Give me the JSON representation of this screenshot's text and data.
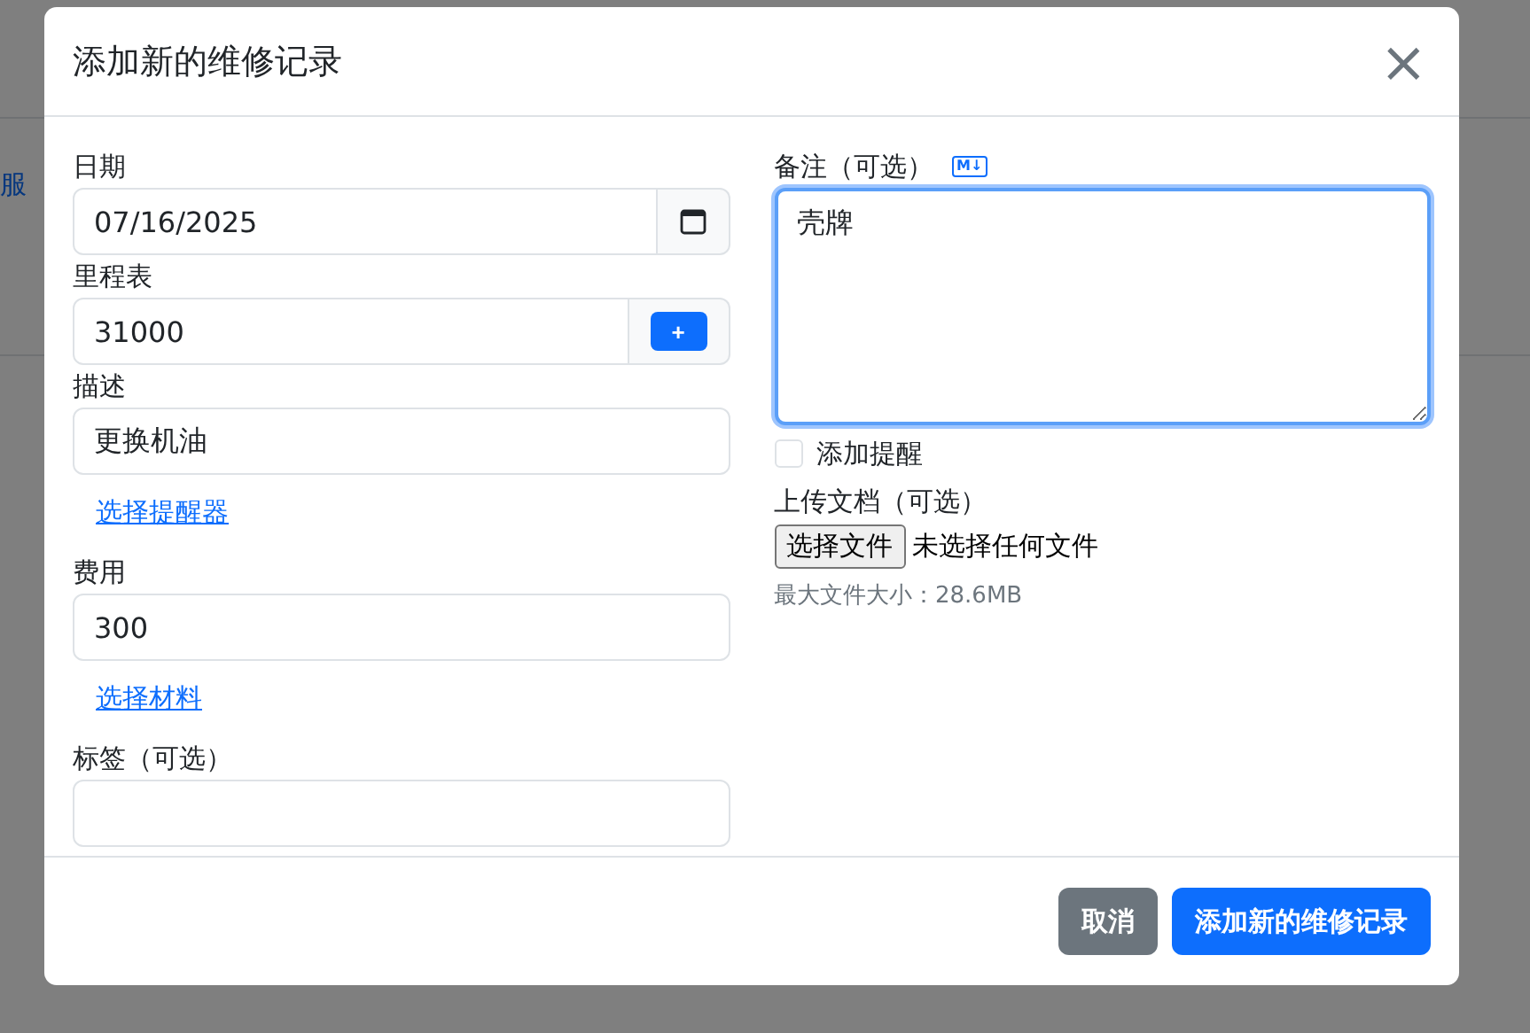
{
  "background": {
    "link": "服"
  },
  "dialog": {
    "title": "添加新的维修记录",
    "close": "×"
  },
  "left_column": [
    {
      "kind": "date",
      "label": "日期",
      "value": "07/16/2025"
    },
    {
      "kind": "input-button",
      "label": "里程表",
      "value": "31000",
      "button": "+"
    },
    {
      "kind": "input",
      "label": "描述",
      "value": "更换机油"
    },
    {
      "kind": "link",
      "text": "选择提醒器"
    },
    {
      "kind": "input",
      "label": "费用",
      "value": "300"
    },
    {
      "kind": "link",
      "text": "选择材料"
    },
    {
      "kind": "input",
      "label": "标签（可选）"
    }
  ],
  "notes": {
    "label": "备注（可选）",
    "badge": "M↓",
    "value": "壳牌",
    "focused": true
  },
  "reminder": {
    "label": "添加提醒",
    "checked": false
  },
  "upload": {
    "label": "上传文档（可选）",
    "button": "选择文件",
    "status": "未选择任何文件",
    "hint": "最大文件大小：28.6MB"
  },
  "footer": {
    "buttons": [
      {
        "kind": "secondary",
        "label": "取消"
      },
      {
        "kind": "primary",
        "label": "添加新的维修记录"
      }
    ]
  }
}
